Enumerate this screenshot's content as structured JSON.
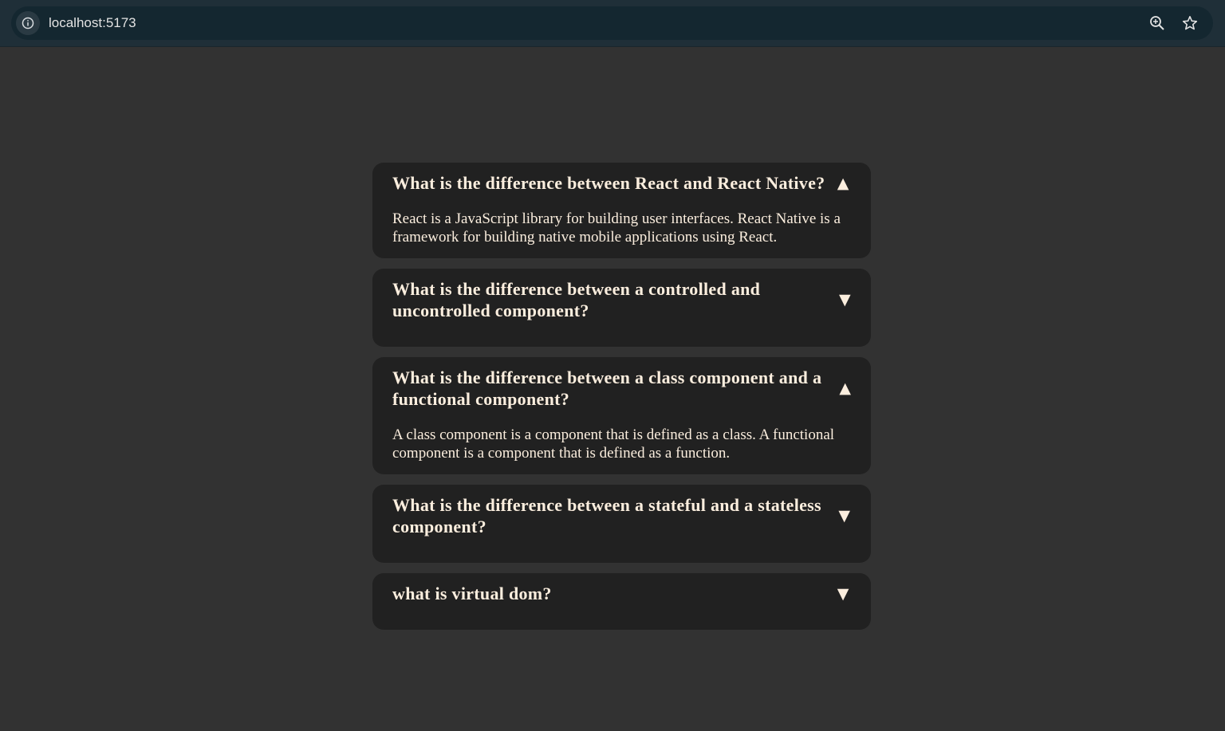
{
  "browser": {
    "url": "localhost:5173"
  },
  "faqs": [
    {
      "question": "What is the difference between React and React Native?",
      "toggle": "▲",
      "open": true,
      "answer": "React is a JavaScript library for building user interfaces. React Native is a framework for building native mobile applications using React."
    },
    {
      "question": "What is the difference between a controlled and uncontrolled component?",
      "toggle": "▼",
      "open": false,
      "answer": ""
    },
    {
      "question": "What is the difference between a class component and a functional component?",
      "toggle": "▲",
      "open": true,
      "answer": "A class component is a component that is defined as a class. A functional component is a component that is defined as a function."
    },
    {
      "question": "What is the difference between a stateful and a stateless component?",
      "toggle": "▼",
      "open": false,
      "answer": ""
    },
    {
      "question": "what is virtual dom?",
      "toggle": "▼",
      "open": false,
      "answer": ""
    }
  ],
  "colors": {
    "page_bg": "#323232",
    "card_bg": "#212121",
    "text": "#fbeede"
  }
}
